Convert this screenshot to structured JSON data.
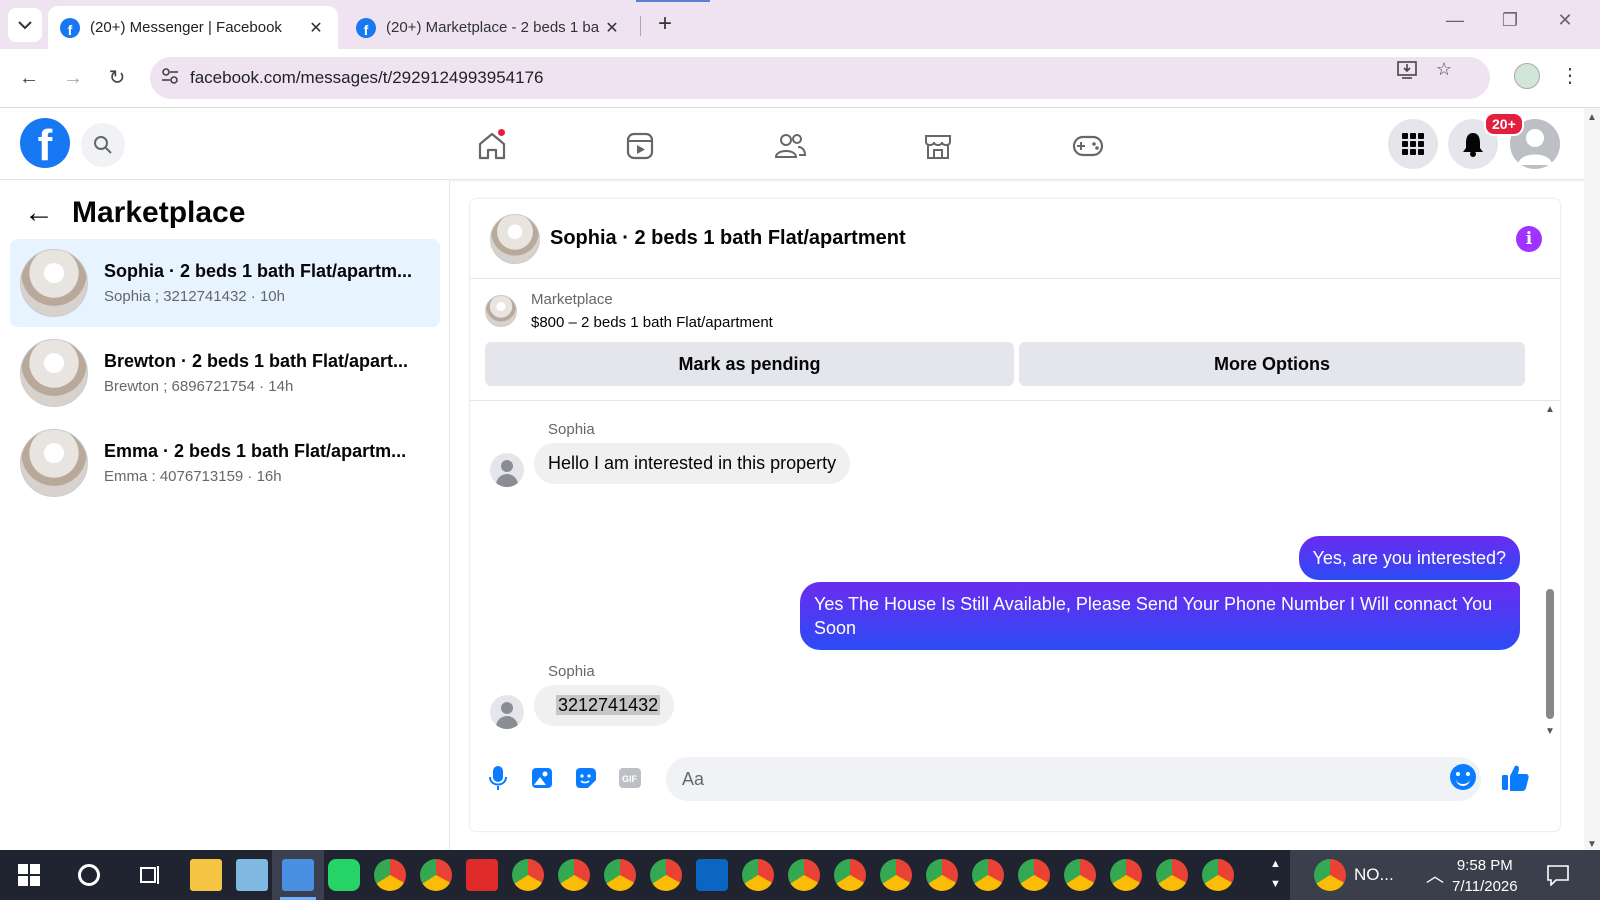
{
  "browser": {
    "tabs": [
      {
        "title": "(20+) Messenger | Facebook",
        "active": true
      },
      {
        "title": "(20+) Marketplace - 2 beds 1 ba",
        "active": false
      }
    ],
    "url": "facebook.com/messages/t/2929124993954176"
  },
  "fb_header": {
    "notification_badge": "20+"
  },
  "left_panel": {
    "title": "Marketplace",
    "conversations": [
      {
        "name": "Sophia · 2 beds 1 bath Flat/apartm...",
        "sub": "Sophia ; 3212741432 · 10h",
        "active": true
      },
      {
        "name": "Brewton · 2 beds 1 bath Flat/apart...",
        "sub": "Brewton ; 6896721754 · 14h",
        "active": false
      },
      {
        "name": "Emma · 2 beds 1 bath Flat/apartm...",
        "sub": "Emma : 4076713159 · 16h",
        "active": false
      }
    ]
  },
  "chat": {
    "title": "Sophia · 2 beds 1 bath Flat/apartment",
    "listing_label": "Marketplace",
    "listing_price": "$800 – 2 beds 1 bath Flat/apartment",
    "mark_pending_label": "Mark as pending",
    "more_options_label": "More Options",
    "messages": [
      {
        "sender": "Sophia",
        "text": "Hello I am interested in this property",
        "direction": "in"
      },
      {
        "text": "Yes, are you interested?",
        "direction": "out"
      },
      {
        "text": "Yes The House Is Still Available, Please Send Your Phone Number I Will connact You Soon",
        "direction": "out"
      },
      {
        "sender": "Sophia",
        "text": "3212741432",
        "direction": "in"
      }
    ],
    "composer_placeholder": "Aa"
  },
  "taskbar": {
    "tray_label": "NO...",
    "time": "9:58 PM",
    "date": "7/11/2026"
  },
  "colors": {
    "fb_blue": "#1877f2",
    "messenger_gradient_top": "#6b2bf0",
    "messenger_gradient_bottom": "#2b4cf5",
    "active_conversation_bg": "#e7f3ff",
    "info_purple": "#a033ff",
    "badge_red": "#e41e3f"
  }
}
